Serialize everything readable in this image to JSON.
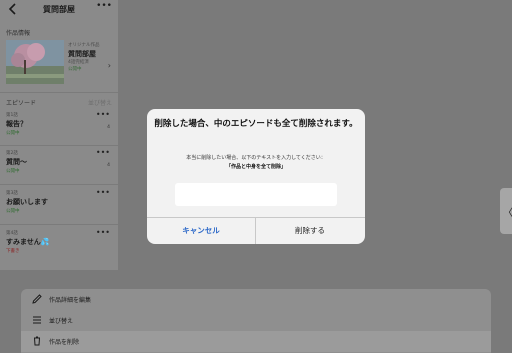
{
  "header": {
    "title": "質問部屋",
    "more_glyph": "•••"
  },
  "work_info": {
    "section_label": "作品情報",
    "category": "オリジナル作品",
    "title": "質問部屋",
    "episodes_label": "4話完結済",
    "status": "公開中"
  },
  "episodes": {
    "section_label": "エピソード",
    "sort_label": "並び替え",
    "items": [
      {
        "num": "第1話",
        "title": "報告？",
        "status": "公開中",
        "count": "4"
      },
      {
        "num": "第2話",
        "title": "質問〜",
        "status": "公開中",
        "count": "4"
      },
      {
        "num": "第3話",
        "title": "お願いします",
        "status": "公開中",
        "count": ""
      },
      {
        "num": "第4話",
        "title": "すみません💦",
        "status": "下書き",
        "count": ""
      }
    ]
  },
  "sheet": {
    "items": [
      {
        "label": "作品詳細を編集",
        "icon": "pencil-icon"
      },
      {
        "label": "並び替え",
        "icon": "list-icon"
      },
      {
        "label": "作品を削除",
        "icon": "trash-icon"
      }
    ]
  },
  "dialog": {
    "title": "削除した場合、中のエピソードも全て削除されます。",
    "message": "本当に削除したい場合、以下のテキストを入力してください：",
    "required_text": "「作品と中身を全て削除」",
    "input_value": "",
    "input_placeholder": "",
    "cancel_label": "キャンセル",
    "delete_label": "削除する"
  },
  "colors": {
    "accent": "#2a67c8",
    "published_green": "#2e6b2e",
    "draft_red": "#8a2323"
  },
  "handle_glyph": "〈"
}
